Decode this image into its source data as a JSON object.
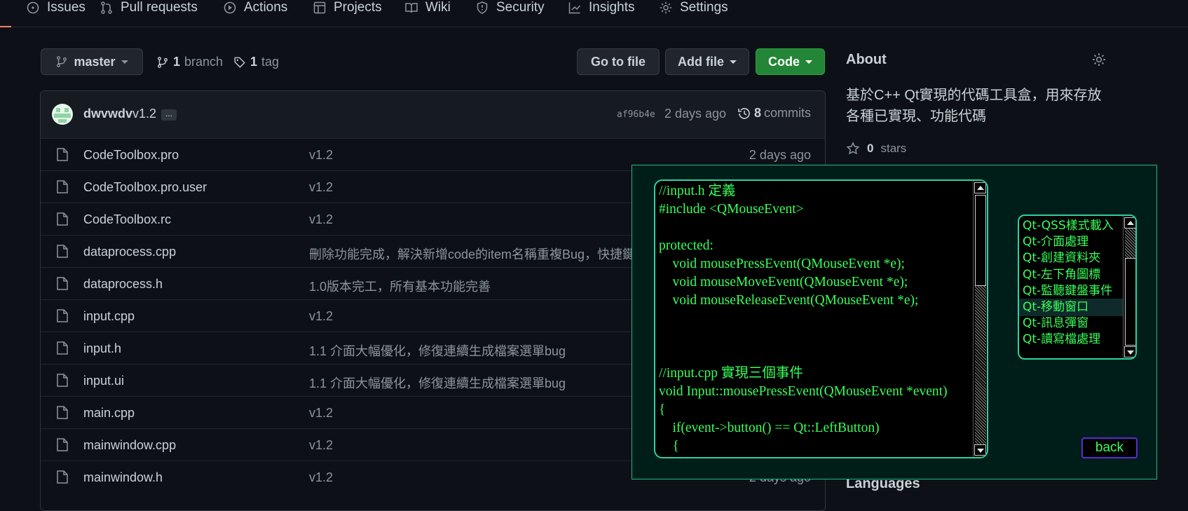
{
  "nav": {
    "items": [
      "Issues",
      "Pull requests",
      "Actions",
      "Projects",
      "Wiki",
      "Security",
      "Insights",
      "Settings"
    ]
  },
  "repo": {
    "branch_button": "master",
    "branch_count": "1",
    "branch_label": "branch",
    "tag_count": "1",
    "tag_label": "tag",
    "go_to_file": "Go to file",
    "add_file": "Add file",
    "code": "Code"
  },
  "commit": {
    "author": "dwvwdv",
    "message": "v1.2",
    "ellipsis": "...",
    "sha": "af96b4e",
    "age": "2 days ago",
    "commits_count": "8",
    "commits_label": "commits"
  },
  "files": [
    {
      "name": "CodeToolbox.pro",
      "message": "v1.2",
      "age": "2 days ago"
    },
    {
      "name": "CodeToolbox.pro.user",
      "message": "v1.2",
      "age": ""
    },
    {
      "name": "CodeToolbox.rc",
      "message": "v1.2",
      "age": ""
    },
    {
      "name": "dataprocess.cpp",
      "message": "刪除功能完成，解決新增code的item名稱重複Bug，快捷鍵功",
      "age": ""
    },
    {
      "name": "dataprocess.h",
      "message": "1.0版本完工，所有基本功能完善",
      "age": ""
    },
    {
      "name": "input.cpp",
      "message": "v1.2",
      "age": ""
    },
    {
      "name": "input.h",
      "message": "1.1 介面大幅優化，修復連續生成檔案選單bug",
      "age": ""
    },
    {
      "name": "input.ui",
      "message": "1.1 介面大幅優化，修復連續生成檔案選單bug",
      "age": ""
    },
    {
      "name": "main.cpp",
      "message": "v1.2",
      "age": ""
    },
    {
      "name": "mainwindow.cpp",
      "message": "v1.2",
      "age": ""
    },
    {
      "name": "mainwindow.h",
      "message": "v1.2",
      "age": "2 days ago"
    }
  ],
  "about": {
    "title": "About",
    "description_line1": "基於C++ Qt實現的代碼工具盒，用來存放",
    "description_line2": "各種已實現、功能代碼",
    "stars_count": "0",
    "stars_label": "stars",
    "languages": "Languages"
  },
  "app": {
    "code_text": "//input.h 定義\n#include <QMouseEvent>\n\nprotected:\n    void mousePressEvent(QMouseEvent *e);\n    void mouseMoveEvent(QMouseEvent *e);\n    void mouseReleaseEvent(QMouseEvent *e);\n\n\n\n//input.cpp 實現三個事件\nvoid Input::mousePressEvent(QMouseEvent *event)\n{\n    if(event->button() == Qt::LeftButton)\n    {",
    "list_items": [
      "Qt-QSS樣式載入",
      "Qt-介面處理",
      "Qt-創建資料夾",
      "Qt-左下角圖標",
      "Qt-監聽鍵盤事件",
      "Qt-移動窗口",
      "Qt-訊息彈窗",
      "Qt-讀寫檔處理"
    ],
    "selected_index": 5,
    "back_label": "back"
  },
  "colors": {
    "bg": "#0d1117",
    "green_button": "#238636",
    "app_text": "#39ff59",
    "app_border": "#2fd1a1"
  }
}
